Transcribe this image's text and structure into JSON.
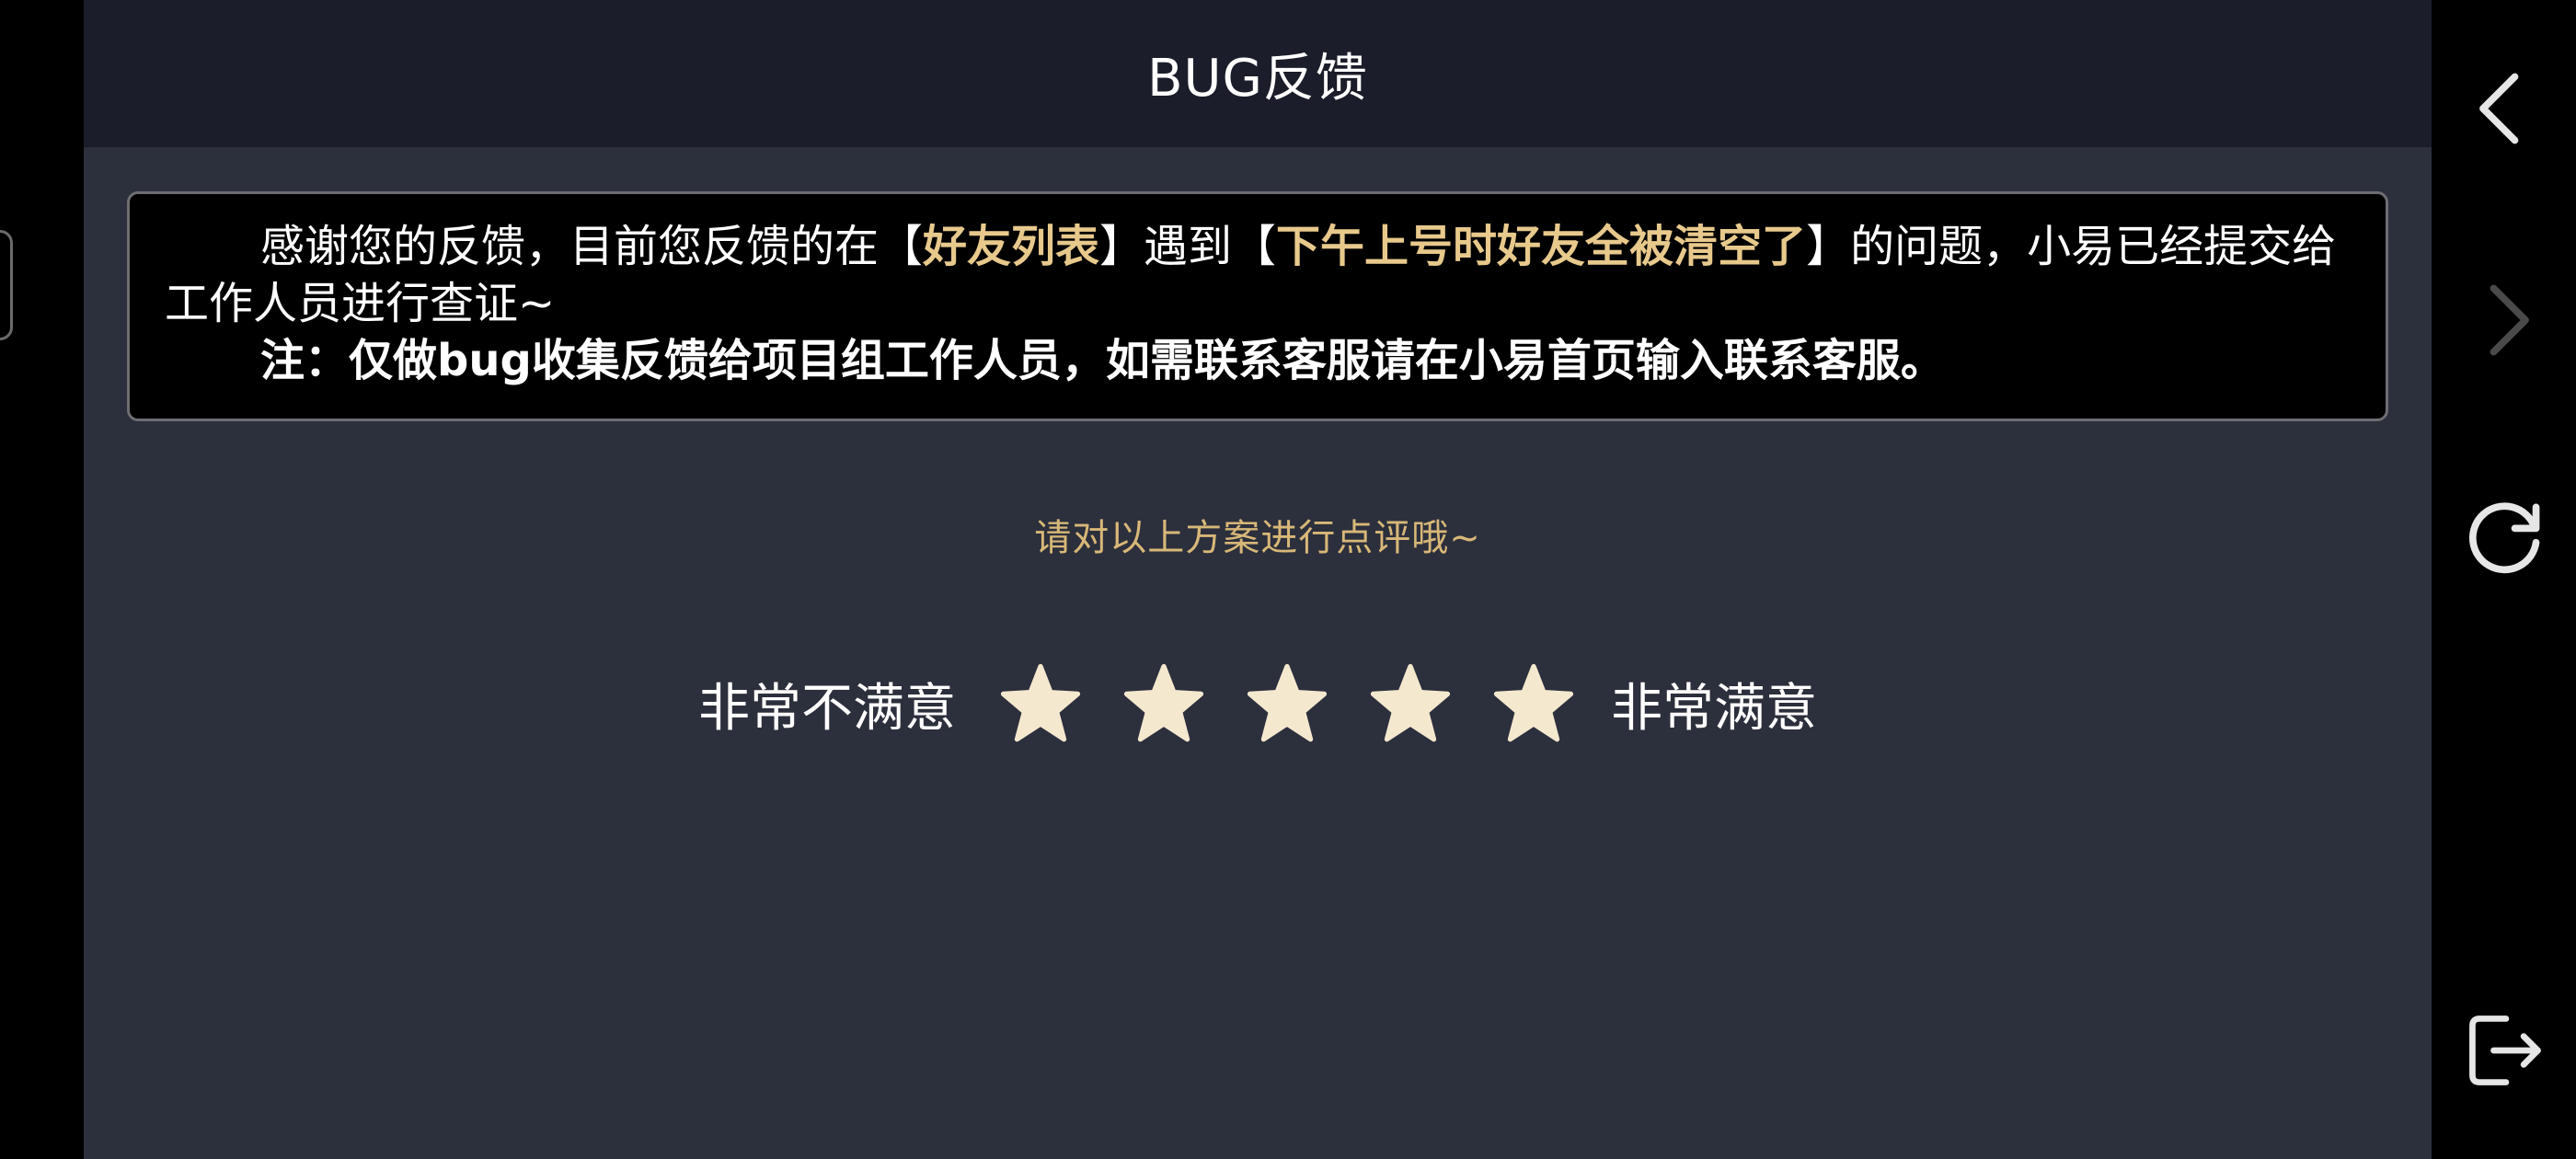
{
  "header": {
    "title": "BUG反馈"
  },
  "notice": {
    "seg1": "感谢您的反馈，目前您反馈的在【",
    "module": "好友列表",
    "seg2": "】遇到【",
    "issue": "下午上号时好友全被清空了",
    "seg3": "】的问题，小易已经提交给工作人员进行查证~",
    "note": "注：仅做bug收集反馈给项目组工作人员，如需联系客服请在小易首页输入联系客服。"
  },
  "rating": {
    "prompt": "请对以上方案进行点评哦~",
    "low_label": "非常不满意",
    "high_label": "非常满意",
    "star_count": 5,
    "star_color": "#f4e8cf"
  },
  "nav": {
    "icons": [
      "back-icon",
      "forward-icon",
      "refresh-icon",
      "exit-icon"
    ]
  },
  "colors": {
    "highlight": "#e8c98c",
    "prompt": "#d8b878",
    "app_background": "#2c2f3c",
    "header_background": "#1b1d2a"
  }
}
